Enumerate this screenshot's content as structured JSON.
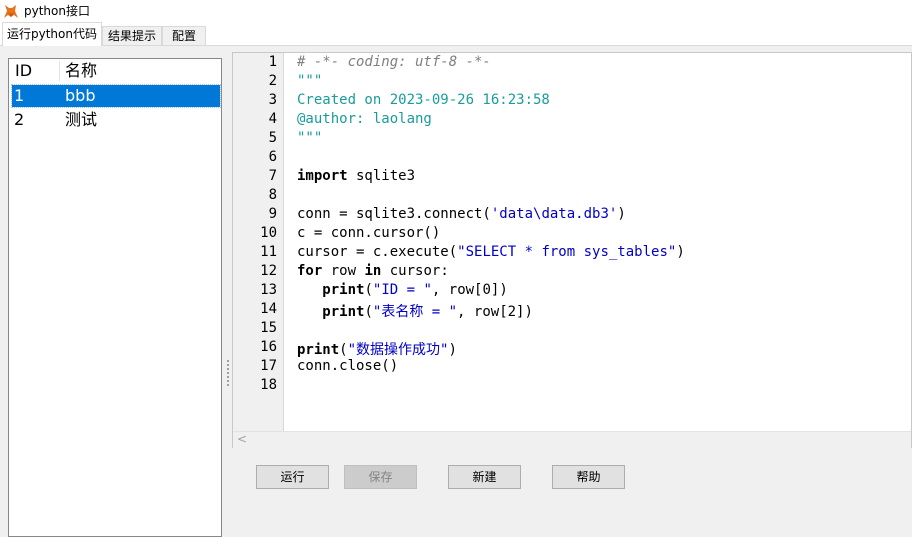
{
  "window": {
    "title": "python接口",
    "icon": "fox-icon"
  },
  "tabs": [
    {
      "label": "运行python代码",
      "active": true
    },
    {
      "label": "结果提示",
      "active": false
    },
    {
      "label": "配置",
      "active": false
    }
  ],
  "table_list": {
    "columns": [
      "ID",
      "名称"
    ],
    "rows": [
      {
        "id": "1",
        "name": "bbb",
        "selected": true
      },
      {
        "id": "2",
        "name": "测试",
        "selected": false
      }
    ]
  },
  "editor": {
    "line_numbers": [
      "1",
      "2",
      "3",
      "4",
      "5",
      "6",
      "7",
      "8",
      "9",
      "10",
      "11",
      "12",
      "13",
      "14",
      "15",
      "16",
      "17",
      "18"
    ],
    "lines": [
      [
        [
          "cmt",
          "# -*- coding: utf-8 -*-"
        ]
      ],
      [
        [
          "doc",
          "\"\"\""
        ]
      ],
      [
        [
          "doc",
          "Created on 2023-09-26 16:23:58"
        ]
      ],
      [
        [
          "doc",
          "@author: laolang"
        ]
      ],
      [
        [
          "doc",
          "\"\"\""
        ]
      ],
      [],
      [
        [
          "kw",
          "import"
        ],
        [
          "",
          " sqlite3"
        ]
      ],
      [],
      [
        [
          "",
          "conn = sqlite3.connect("
        ],
        [
          "str",
          "'data\\data.db3'"
        ],
        [
          "",
          ")"
        ]
      ],
      [
        [
          "",
          "c = conn.cursor()"
        ]
      ],
      [
        [
          "",
          "cursor = c.execute("
        ],
        [
          "str",
          "\"SELECT * from sys_tables\""
        ],
        [
          "",
          ")"
        ]
      ],
      [
        [
          "kw",
          "for"
        ],
        [
          "",
          " row "
        ],
        [
          "kw",
          "in"
        ],
        [
          "",
          " cursor:"
        ]
      ],
      [
        [
          "",
          "   "
        ],
        [
          "kw",
          "print"
        ],
        [
          "",
          "("
        ],
        [
          "str",
          "\"ID = \""
        ],
        [
          "",
          ", row[0])"
        ]
      ],
      [
        [
          "",
          "   "
        ],
        [
          "kw",
          "print"
        ],
        [
          "",
          "("
        ],
        [
          "str",
          "\"表名称 = \""
        ],
        [
          "",
          ", row[2])"
        ]
      ],
      [],
      [
        [
          "kw",
          "print"
        ],
        [
          "",
          "("
        ],
        [
          "str",
          "\"数据操作成功\""
        ],
        [
          "",
          ")"
        ]
      ],
      [
        [
          "",
          "conn.close()"
        ]
      ],
      []
    ]
  },
  "buttons": {
    "run": "运行",
    "save": "保存",
    "new": "新建",
    "help": "帮助"
  },
  "colors": {
    "selection": "#0078d7",
    "docstring": "#1a9c9c",
    "string": "#0000c8",
    "comment": "#808080"
  }
}
